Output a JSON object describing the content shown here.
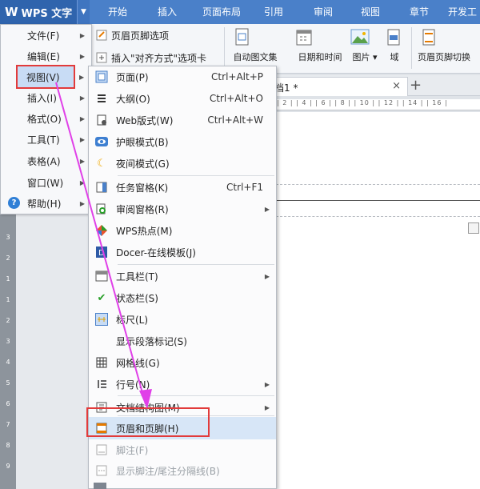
{
  "app": {
    "name": "WPS 文字"
  },
  "menubar": {
    "tabs": [
      "开始",
      "插入",
      "页面布局",
      "引用",
      "审阅",
      "视图",
      "章节",
      "开发工"
    ]
  },
  "ribbon": {
    "header_footer_options": "页眉页脚选项",
    "insert_align_tab": "插入\"对齐方式\"选项卡",
    "auto_doc_set": "自动图文集",
    "date_time": "日期和时间",
    "picture": "图片",
    "field": "域",
    "header_footer_switch": "页眉页脚切换"
  },
  "doc_tab": {
    "title": "档1 *",
    "close": "×",
    "add": "+"
  },
  "ruler_text": "| 2 |  | 4 |  | 6 |  | 8 |  | 10 | | 12 | | 14 | | 16 |",
  "vertical_ruler": [
    "3",
    "2",
    "1",
    "1",
    "2",
    "3",
    "4",
    "5",
    "6",
    "7",
    "8",
    "9",
    "10",
    "11",
    "12",
    "13",
    "14",
    "15",
    "16"
  ],
  "main_menu": {
    "items": [
      {
        "label": "文件(F)"
      },
      {
        "label": "编辑(E)"
      },
      {
        "label": "视图(V)"
      },
      {
        "label": "插入(I)"
      },
      {
        "label": "格式(O)"
      },
      {
        "label": "工具(T)"
      },
      {
        "label": "表格(A)"
      },
      {
        "label": "窗口(W)"
      },
      {
        "label": "帮助(H)"
      }
    ]
  },
  "view_submenu": {
    "items": [
      {
        "label": "页面(P)",
        "shortcut": "Ctrl+Alt+P"
      },
      {
        "label": "大纲(O)",
        "shortcut": "Ctrl+Alt+O"
      },
      {
        "label": "Web版式(W)",
        "shortcut": "Ctrl+Alt+W"
      },
      {
        "label": "护眼模式(B)",
        "shortcut": ""
      },
      {
        "label": "夜间模式(G)",
        "shortcut": ""
      },
      {
        "label": "任务窗格(K)",
        "shortcut": "Ctrl+F1"
      },
      {
        "label": "审阅窗格(R)",
        "shortcut": ""
      },
      {
        "label": "WPS热点(M)",
        "shortcut": ""
      },
      {
        "label": "Docer-在线模板(J)",
        "shortcut": ""
      },
      {
        "label": "工具栏(T)",
        "shortcut": ""
      },
      {
        "label": "状态栏(S)",
        "shortcut": ""
      },
      {
        "label": "标尺(L)",
        "shortcut": ""
      },
      {
        "label": "显示段落标记(S)",
        "shortcut": ""
      },
      {
        "label": "网格线(G)",
        "shortcut": ""
      },
      {
        "label": "行号(N)",
        "shortcut": ""
      },
      {
        "label": "文档结构图(M)",
        "shortcut": ""
      },
      {
        "label": "页眉和页脚(H)",
        "shortcut": ""
      },
      {
        "label": "脚注(F)",
        "shortcut": ""
      },
      {
        "label": "显示脚注/尾注分隔线(B)",
        "shortcut": ""
      }
    ]
  },
  "colors": {
    "menubar": "#4a80c9",
    "highlight_red": "#e23b3b",
    "arrow_magenta": "#e040e8"
  }
}
